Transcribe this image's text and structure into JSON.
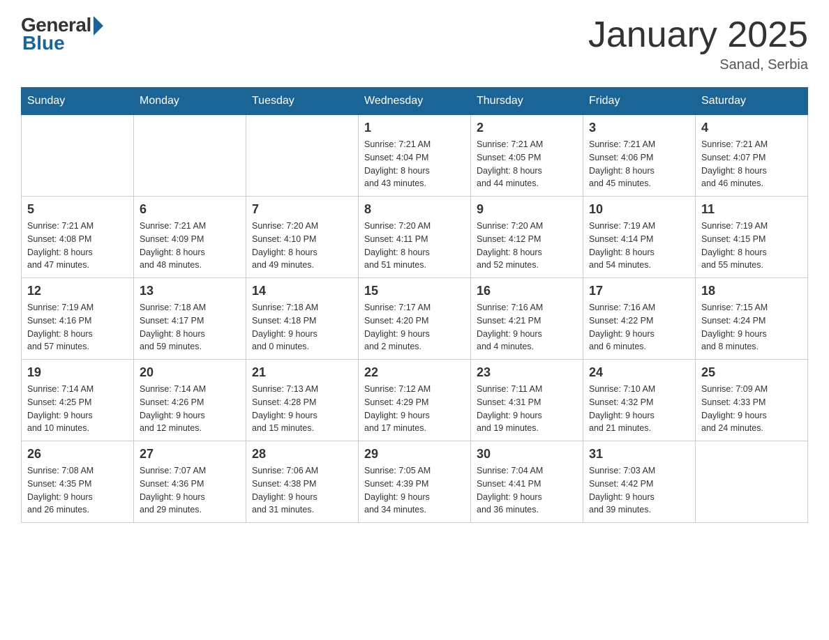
{
  "logo": {
    "general": "General",
    "blue": "Blue"
  },
  "title": "January 2025",
  "location": "Sanad, Serbia",
  "days_header": [
    "Sunday",
    "Monday",
    "Tuesday",
    "Wednesday",
    "Thursday",
    "Friday",
    "Saturday"
  ],
  "weeks": [
    [
      {
        "num": "",
        "info": ""
      },
      {
        "num": "",
        "info": ""
      },
      {
        "num": "",
        "info": ""
      },
      {
        "num": "1",
        "info": "Sunrise: 7:21 AM\nSunset: 4:04 PM\nDaylight: 8 hours\nand 43 minutes."
      },
      {
        "num": "2",
        "info": "Sunrise: 7:21 AM\nSunset: 4:05 PM\nDaylight: 8 hours\nand 44 minutes."
      },
      {
        "num": "3",
        "info": "Sunrise: 7:21 AM\nSunset: 4:06 PM\nDaylight: 8 hours\nand 45 minutes."
      },
      {
        "num": "4",
        "info": "Sunrise: 7:21 AM\nSunset: 4:07 PM\nDaylight: 8 hours\nand 46 minutes."
      }
    ],
    [
      {
        "num": "5",
        "info": "Sunrise: 7:21 AM\nSunset: 4:08 PM\nDaylight: 8 hours\nand 47 minutes."
      },
      {
        "num": "6",
        "info": "Sunrise: 7:21 AM\nSunset: 4:09 PM\nDaylight: 8 hours\nand 48 minutes."
      },
      {
        "num": "7",
        "info": "Sunrise: 7:20 AM\nSunset: 4:10 PM\nDaylight: 8 hours\nand 49 minutes."
      },
      {
        "num": "8",
        "info": "Sunrise: 7:20 AM\nSunset: 4:11 PM\nDaylight: 8 hours\nand 51 minutes."
      },
      {
        "num": "9",
        "info": "Sunrise: 7:20 AM\nSunset: 4:12 PM\nDaylight: 8 hours\nand 52 minutes."
      },
      {
        "num": "10",
        "info": "Sunrise: 7:19 AM\nSunset: 4:14 PM\nDaylight: 8 hours\nand 54 minutes."
      },
      {
        "num": "11",
        "info": "Sunrise: 7:19 AM\nSunset: 4:15 PM\nDaylight: 8 hours\nand 55 minutes."
      }
    ],
    [
      {
        "num": "12",
        "info": "Sunrise: 7:19 AM\nSunset: 4:16 PM\nDaylight: 8 hours\nand 57 minutes."
      },
      {
        "num": "13",
        "info": "Sunrise: 7:18 AM\nSunset: 4:17 PM\nDaylight: 8 hours\nand 59 minutes."
      },
      {
        "num": "14",
        "info": "Sunrise: 7:18 AM\nSunset: 4:18 PM\nDaylight: 9 hours\nand 0 minutes."
      },
      {
        "num": "15",
        "info": "Sunrise: 7:17 AM\nSunset: 4:20 PM\nDaylight: 9 hours\nand 2 minutes."
      },
      {
        "num": "16",
        "info": "Sunrise: 7:16 AM\nSunset: 4:21 PM\nDaylight: 9 hours\nand 4 minutes."
      },
      {
        "num": "17",
        "info": "Sunrise: 7:16 AM\nSunset: 4:22 PM\nDaylight: 9 hours\nand 6 minutes."
      },
      {
        "num": "18",
        "info": "Sunrise: 7:15 AM\nSunset: 4:24 PM\nDaylight: 9 hours\nand 8 minutes."
      }
    ],
    [
      {
        "num": "19",
        "info": "Sunrise: 7:14 AM\nSunset: 4:25 PM\nDaylight: 9 hours\nand 10 minutes."
      },
      {
        "num": "20",
        "info": "Sunrise: 7:14 AM\nSunset: 4:26 PM\nDaylight: 9 hours\nand 12 minutes."
      },
      {
        "num": "21",
        "info": "Sunrise: 7:13 AM\nSunset: 4:28 PM\nDaylight: 9 hours\nand 15 minutes."
      },
      {
        "num": "22",
        "info": "Sunrise: 7:12 AM\nSunset: 4:29 PM\nDaylight: 9 hours\nand 17 minutes."
      },
      {
        "num": "23",
        "info": "Sunrise: 7:11 AM\nSunset: 4:31 PM\nDaylight: 9 hours\nand 19 minutes."
      },
      {
        "num": "24",
        "info": "Sunrise: 7:10 AM\nSunset: 4:32 PM\nDaylight: 9 hours\nand 21 minutes."
      },
      {
        "num": "25",
        "info": "Sunrise: 7:09 AM\nSunset: 4:33 PM\nDaylight: 9 hours\nand 24 minutes."
      }
    ],
    [
      {
        "num": "26",
        "info": "Sunrise: 7:08 AM\nSunset: 4:35 PM\nDaylight: 9 hours\nand 26 minutes."
      },
      {
        "num": "27",
        "info": "Sunrise: 7:07 AM\nSunset: 4:36 PM\nDaylight: 9 hours\nand 29 minutes."
      },
      {
        "num": "28",
        "info": "Sunrise: 7:06 AM\nSunset: 4:38 PM\nDaylight: 9 hours\nand 31 minutes."
      },
      {
        "num": "29",
        "info": "Sunrise: 7:05 AM\nSunset: 4:39 PM\nDaylight: 9 hours\nand 34 minutes."
      },
      {
        "num": "30",
        "info": "Sunrise: 7:04 AM\nSunset: 4:41 PM\nDaylight: 9 hours\nand 36 minutes."
      },
      {
        "num": "31",
        "info": "Sunrise: 7:03 AM\nSunset: 4:42 PM\nDaylight: 9 hours\nand 39 minutes."
      },
      {
        "num": "",
        "info": ""
      }
    ]
  ]
}
